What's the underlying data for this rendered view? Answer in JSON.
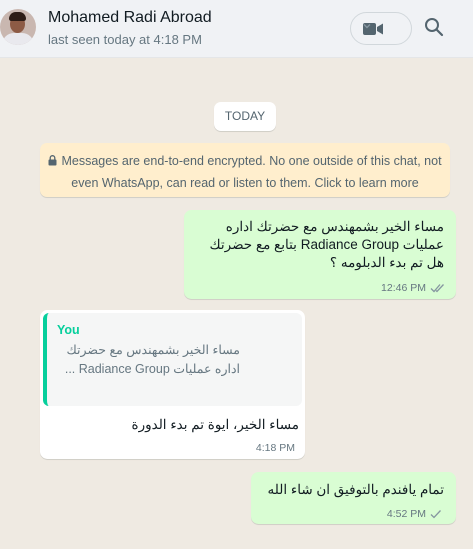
{
  "header": {
    "contact_name": "Mohamed Radi Abroad",
    "last_seen": "last seen today at 4:18 PM"
  },
  "chat": {
    "date_separator": "TODAY",
    "encryption_notice": "Messages are end-to-end encrypted. No one outside of this chat, not even WhatsApp, can read or listen to them. Click to learn more",
    "messages": [
      {
        "direction": "outgoing",
        "text": "مساء الخير بشمهندس  مع حضرتك  اداره عمليات Radiance Group بتابع مع حضرتك هل تم بدء الدبلومه ؟",
        "time": "12:46 PM",
        "status": "read"
      },
      {
        "direction": "incoming",
        "quoted_author": "You",
        "quoted_text": "مساء الخير بشمهندس  مع حضرتك  اداره عمليات Radiance Group ...",
        "text": "مساء الخير، ايوة تم بدء الدورة",
        "time": "4:18 PM"
      },
      {
        "direction": "outgoing",
        "text": "تمام يافندم بالتوفيق ان شاء الله",
        "time": "4:52 PM",
        "status": "sent"
      }
    ]
  },
  "colors": {
    "chat_background": "#efeae2",
    "outgoing_bubble": "#d9fdd3",
    "incoming_bubble": "#ffffff",
    "encryption_banner": "#ffeecd",
    "accent_green": "#06cf9c",
    "read_tick": "#8696a0"
  }
}
